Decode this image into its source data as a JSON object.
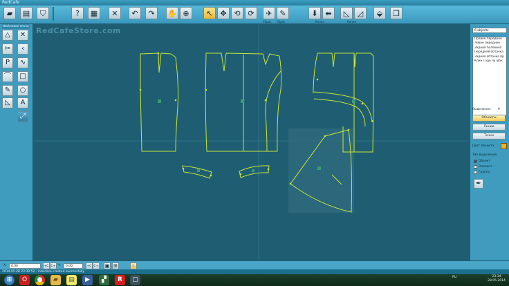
{
  "window": {
    "title": "RedCafe"
  },
  "watermark": "RedCafeStore.com",
  "toolbar": {
    "icons": [
      "open-folder-icon",
      "print-icon",
      "shirt-icon",
      "help-icon",
      "calculator-icon",
      "cut-icon",
      "undo-icon",
      "redo-icon",
      "pan-hand-icon",
      "zoom-icon",
      "select-arrow-icon",
      "move-icon",
      "rotate-icon",
      "rotate-cw-icon",
      "mirror-icon",
      "pen-icon",
      "arrow-down-icon",
      "arrow-left-icon",
      "scale-icon",
      "scale-alt-icon",
      "transform-icon",
      "group-icon"
    ],
    "captions": [
      "Сброс",
      "Сброс",
      "Копия",
      "Копия"
    ]
  },
  "left_panel": {
    "caption": "Файловое меню",
    "tools": [
      "triangle-icon",
      "line-cross-icon",
      "scissors-icon",
      "corner-icon",
      "p-curve-icon",
      "s-curve-icon",
      "bezier-corner-icon",
      "rectangle-icon",
      "pencil-icon",
      "circle-icon",
      "notch-icon",
      "text-a-icon",
      "wave-arrow-icon"
    ]
  },
  "right_panel": {
    "count_label": "6 objects",
    "objects": [
      "Правое переднее",
      "Левое переднее",
      "Задняя половина",
      "Передняя обтачка",
      "Задняя обтачка пр",
      "Клин Годе на юбк"
    ],
    "selection_label": "Выделение:",
    "selection_value": "0",
    "btn_objects": "Объекты",
    "btn_lines": "Линии",
    "btn_points": "Точки",
    "color_label": "Цвет объекта:",
    "selection_type_label": "Тип выделения:",
    "radio_options": [
      "Объект",
      "Элемент",
      "Группа"
    ]
  },
  "statusbar": {
    "x_label": "X:",
    "x_value": "0.00",
    "y_label": "Y:",
    "y_value": "0.00",
    "btn_labels": [
      "+C",
      "C+",
      "+C",
      "C+"
    ]
  },
  "message": "2014.05.28 23:30:52 : interface created successfully",
  "taskbar": {
    "apps": [
      "windows-start-icon",
      "opera-icon",
      "chrome-icon",
      "explorer-folder-icon",
      "notes-icon",
      "media-player-icon",
      "winrar-icon",
      "redcafe-icon",
      "frame-icon"
    ],
    "lang": "RU",
    "time": "23:34",
    "date": "28.05.2014"
  },
  "colors": {
    "canvas_bg": "#1f5e72",
    "pattern_line": "#c9e63a",
    "panel_bg": "#3f9cbf",
    "object_color": "#f0b41c"
  }
}
